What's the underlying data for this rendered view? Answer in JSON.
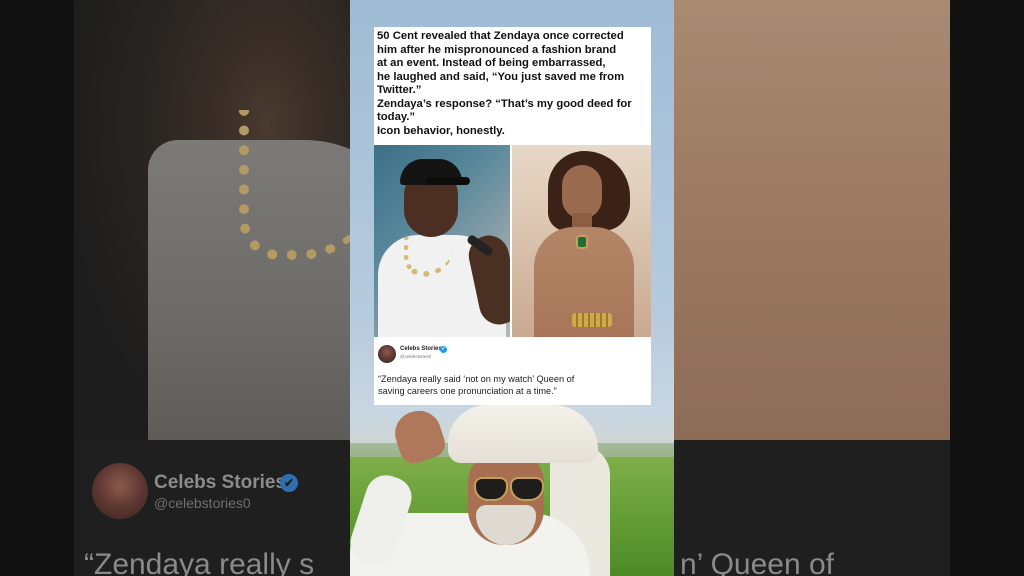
{
  "post": {
    "lines": [
      "50 Cent revealed that Zendaya once corrected",
      "him after he mispronounced a fashion brand",
      "at an event. Instead of being embarrassed,",
      "he laughed and said, “You just saved me from",
      "Twitter.”",
      "Zendaya’s response? “That’s my good deed for",
      "today.”",
      "Icon behavior, honestly."
    ]
  },
  "attribution": {
    "name": "Celebs Stories",
    "handle": "@celebstories0",
    "verified_icon": "✔"
  },
  "quote": {
    "line1": "“Zendaya really said ‘not on my watch’  Queen of",
    "line2": "saving careers one pronunciation at a time.”"
  },
  "background": {
    "name": "Celebs Stories",
    "handle": "@celebstories0",
    "verified_icon": "✔",
    "quote_left": "“Zendaya really s",
    "quote_right": "n’  Queen of"
  },
  "colors": {
    "verified": "#1d9bf0",
    "post_bg": "#ffffff",
    "page_bg": "#0d0d0d"
  }
}
